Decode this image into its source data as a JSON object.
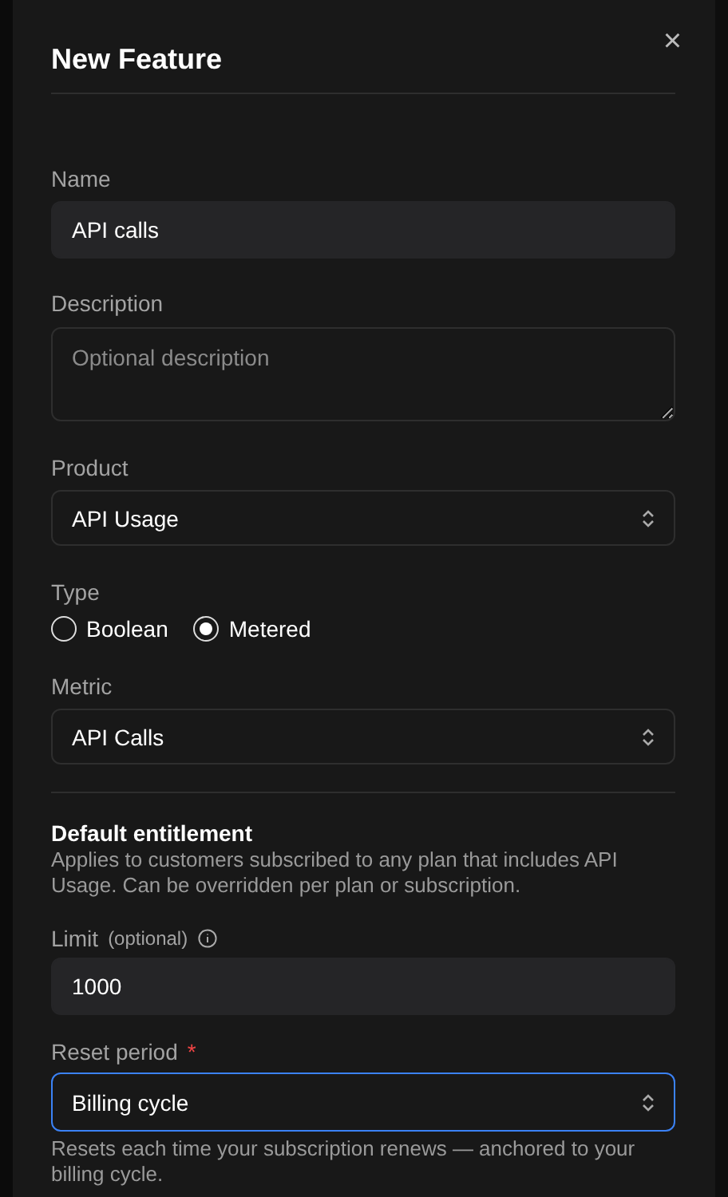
{
  "dialog": {
    "title": "New Feature",
    "close": "×"
  },
  "name": {
    "label": "Name",
    "value": "API calls"
  },
  "description": {
    "label": "Description",
    "placeholder": "Optional description"
  },
  "product": {
    "label": "Product",
    "value": "API Usage"
  },
  "type": {
    "label": "Type",
    "options": [
      {
        "label": "Boolean",
        "selected": false
      },
      {
        "label": "Metered",
        "selected": true
      }
    ]
  },
  "metric": {
    "label": "Metric",
    "value": "API Calls"
  },
  "entitlement": {
    "title": "Default entitlement",
    "text": "Applies to customers subscribed to any plan that includes API Usage. Can be overridden per plan or subscription.",
    "limit": {
      "label": "Limit",
      "note": "(optional)",
      "value": "1000"
    },
    "reset_period": {
      "label": "Reset period",
      "required_mark": "*",
      "value": "Billing cycle",
      "focused": true,
      "hint": "Resets each time your subscription renews — anchored to your billing cycle."
    }
  }
}
